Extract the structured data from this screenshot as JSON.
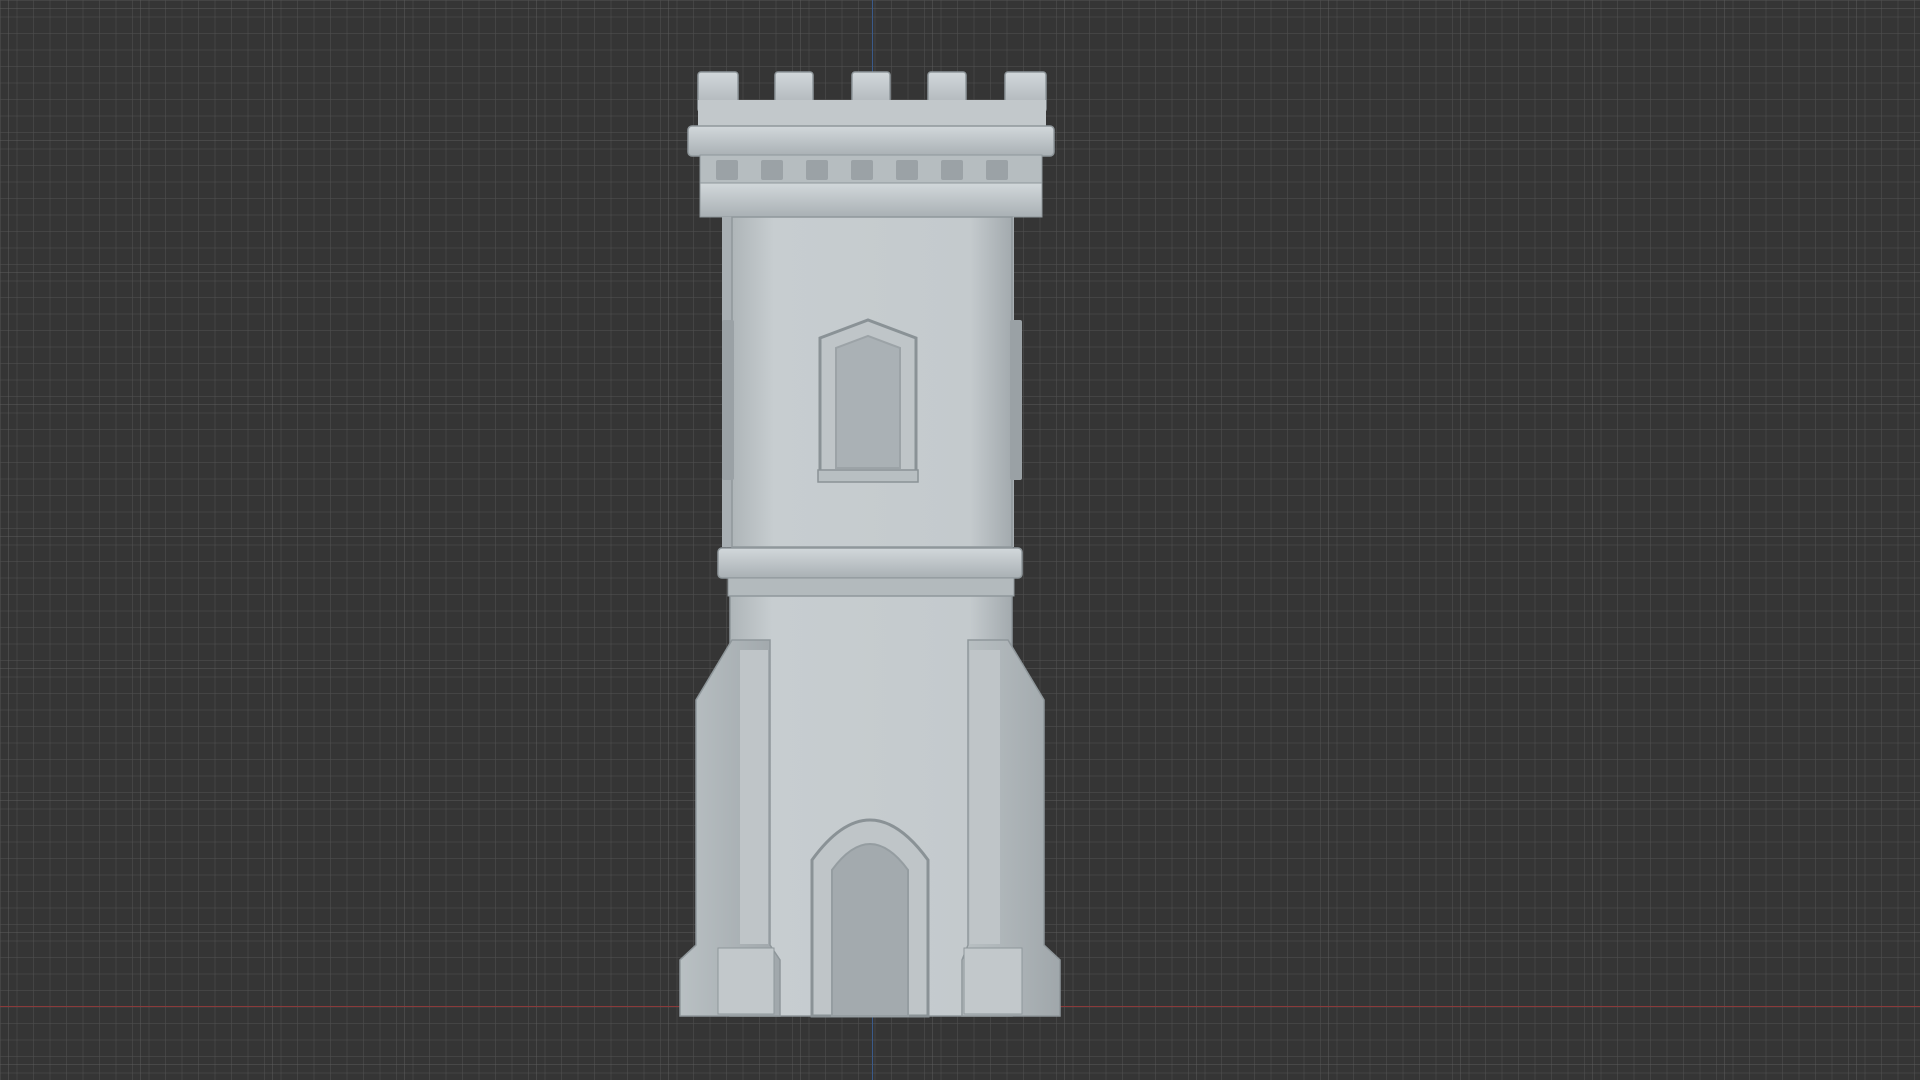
{
  "viewport": {
    "background": "#353535",
    "grid_minor_color": "#505050",
    "grid_major_color": "#5f5f5f",
    "axis_x_color": "#8a3a3a",
    "axis_y_color": "#3a5a8a"
  },
  "model": {
    "name": "castle-tower",
    "shade_light": "#c9cfd2",
    "shade_mid": "#b3babd",
    "shade_dark": "#8f979b",
    "shade_deep": "#6e7579"
  }
}
